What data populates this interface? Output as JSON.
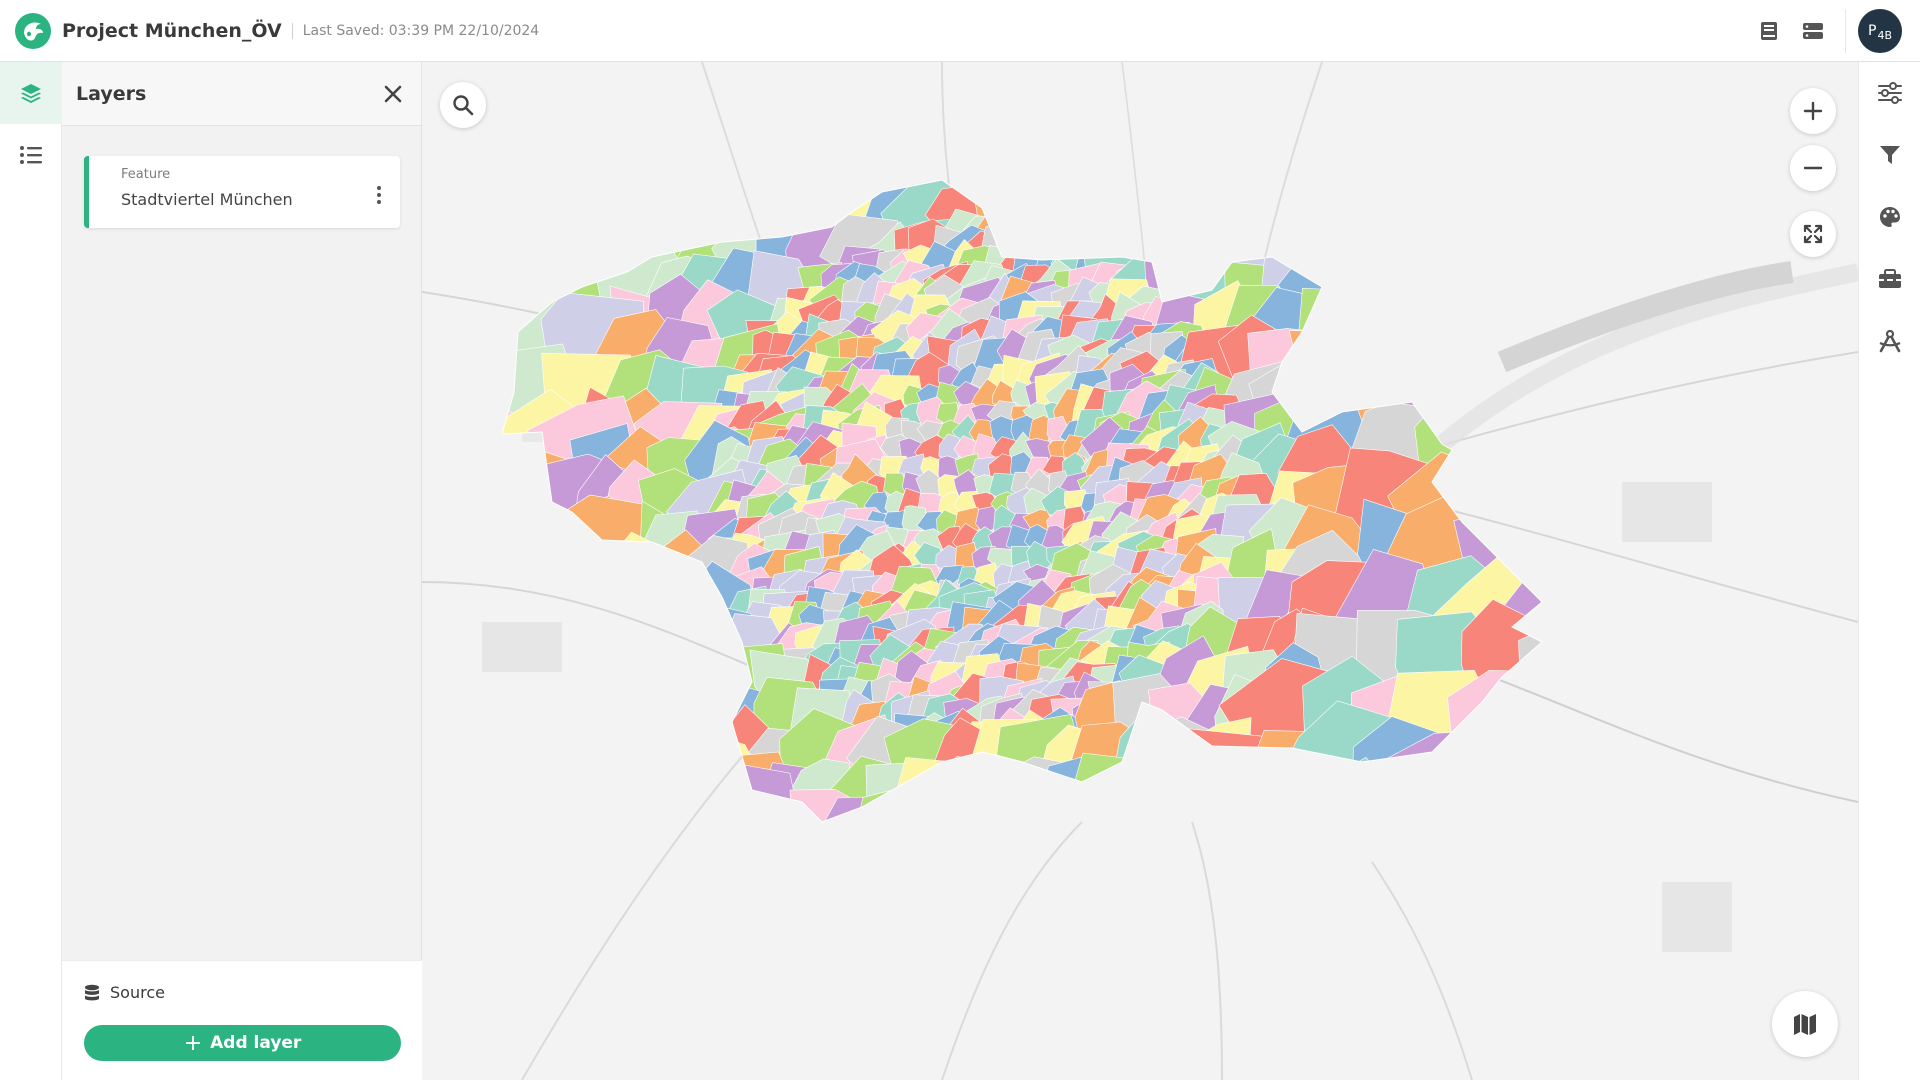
{
  "header": {
    "project_title": "Project München_ÖV",
    "last_saved": "Last Saved: 03:39 PM 22/10/2024",
    "avatar_initials": "P",
    "avatar_sub": "4B",
    "brand_color": "#2bb381"
  },
  "left_rail": {
    "items": [
      {
        "name": "layers",
        "icon": "layers-icon",
        "active": true
      },
      {
        "name": "legend",
        "icon": "list-icon",
        "active": false
      }
    ]
  },
  "layers_panel": {
    "title": "Layers",
    "layers": [
      {
        "type": "Feature",
        "name": "Stadtviertel München"
      }
    ],
    "source_label": "Source",
    "add_layer_label": "Add layer"
  },
  "map_controls": {
    "search_icon": "search-icon",
    "zoom_in_icon": "plus-icon",
    "zoom_out_icon": "minus-icon",
    "fullscreen_icon": "fullscreen-icon",
    "basemap_icon": "map-icon"
  },
  "right_rail": {
    "items": [
      "properties-sliders-icon",
      "filter-icon",
      "style-palette-icon",
      "toolbox-icon",
      "analysis-compass-icon"
    ]
  },
  "map_palette": [
    "#f8857a",
    "#f9ad6a",
    "#fcf5a3",
    "#b2e07a",
    "#9ad9c8",
    "#87b4dc",
    "#c59ad7",
    "#fbc8dc",
    "#cfcfe8",
    "#d6d6d6",
    "#cfe9cf"
  ]
}
